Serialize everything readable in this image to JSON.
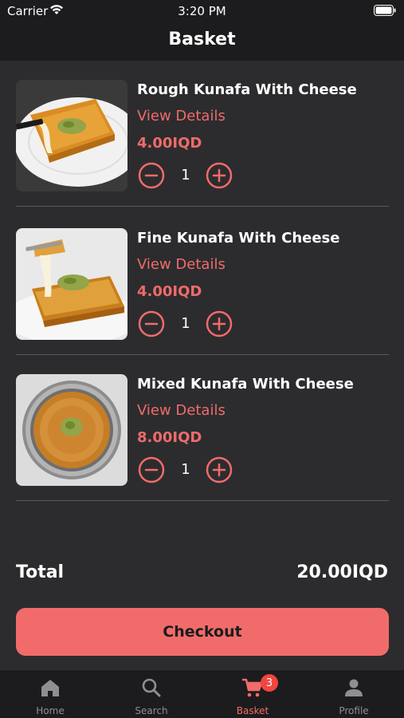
{
  "status_bar": {
    "carrier": "Carrier",
    "time": "3:20 PM"
  },
  "nav": {
    "title": "Basket"
  },
  "items": [
    {
      "name": "Rough Kunafa With Cheese",
      "details_label": "View Details",
      "price": "4.00IQD",
      "quantity": "1",
      "image_icon": "kunafa-slice-on-plate-image"
    },
    {
      "name": "Fine Kunafa With Cheese",
      "details_label": "View Details",
      "price": "4.00IQD",
      "quantity": "1",
      "image_icon": "kunafa-cheese-pull-image"
    },
    {
      "name": "Mixed Kunafa With Cheese",
      "details_label": "View Details",
      "price": "8.00IQD",
      "quantity": "1",
      "image_icon": "kunafa-round-tray-image"
    }
  ],
  "summary": {
    "total_label": "Total",
    "total_value": "20.00IQD"
  },
  "checkout": {
    "label": "Checkout"
  },
  "tabs": [
    {
      "label": "Home",
      "icon": "home-icon",
      "active": false
    },
    {
      "label": "Search",
      "icon": "search-icon",
      "active": false
    },
    {
      "label": "Basket",
      "icon": "cart-icon",
      "active": true,
      "badge": "3"
    },
    {
      "label": "Profile",
      "icon": "person-icon",
      "active": false
    }
  ],
  "colors": {
    "accent": "#f26b6b",
    "background": "#1c1c1e",
    "surface": "#2c2c2e",
    "badge": "#f2453f",
    "inactive": "#8e8e93"
  }
}
